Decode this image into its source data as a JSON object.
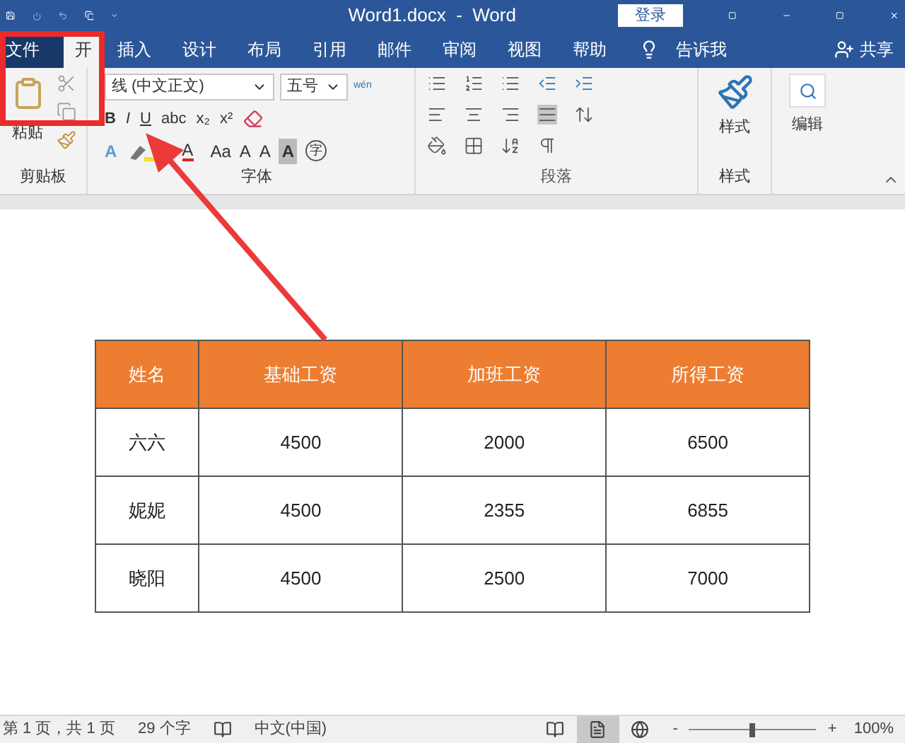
{
  "title_bar": {
    "title": "Word1.docx  -  Word",
    "login_button": "登录"
  },
  "tabs": [
    {
      "label": "文件",
      "kind": "file",
      "selected": false
    },
    {
      "label": "开",
      "kind": "tab",
      "selected": true
    },
    {
      "label": "插入",
      "kind": "tab",
      "selected": false
    },
    {
      "label": "设计",
      "kind": "tab",
      "selected": false
    },
    {
      "label": "布局",
      "kind": "tab",
      "selected": false
    },
    {
      "label": "引用",
      "kind": "tab",
      "selected": false
    },
    {
      "label": "邮件",
      "kind": "tab",
      "selected": false
    },
    {
      "label": "审阅",
      "kind": "tab",
      "selected": false
    },
    {
      "label": "视图",
      "kind": "tab",
      "selected": false
    },
    {
      "label": "帮助",
      "kind": "tab",
      "selected": false
    }
  ],
  "tell_me": "告诉我",
  "share": "共享",
  "ribbon": {
    "clipboard": {
      "paste": "粘贴",
      "group_label": "剪贴板"
    },
    "font": {
      "font_name": "线 (中文正文)",
      "font_size": "五号",
      "phonetic": "wén",
      "row1": [
        "B",
        "I",
        "U",
        "abc",
        "x₂",
        "x²"
      ],
      "row2": [
        "A",
        "A",
        "Aa",
        "A",
        "A",
        "A",
        "字"
      ],
      "group_label": "字体"
    },
    "paragraph": {
      "group_label": "段落"
    },
    "styles": {
      "button": "样式",
      "group_label": "样式"
    },
    "editing": {
      "button": "编辑"
    }
  },
  "table": {
    "columns": [
      "姓名",
      "基础工资",
      "加班工资",
      "所得工资"
    ],
    "rows": [
      [
        "六六",
        "4500",
        "2000",
        "6500"
      ],
      [
        "妮妮",
        "4500",
        "2355",
        "6855"
      ],
      [
        "晓阳",
        "4500",
        "2500",
        "7000"
      ]
    ]
  },
  "status_bar": {
    "page": "第 1 页，共 1 页",
    "words": "29 个字",
    "language": "中文(中国)",
    "views": [
      {
        "kind": "read",
        "selected": false
      },
      {
        "kind": "print",
        "selected": true
      },
      {
        "kind": "web",
        "selected": false
      }
    ],
    "zoom_minus": "-",
    "zoom_plus": "+",
    "zoom": {
      "level": 0.5
    },
    "zoom_text": "100%"
  }
}
